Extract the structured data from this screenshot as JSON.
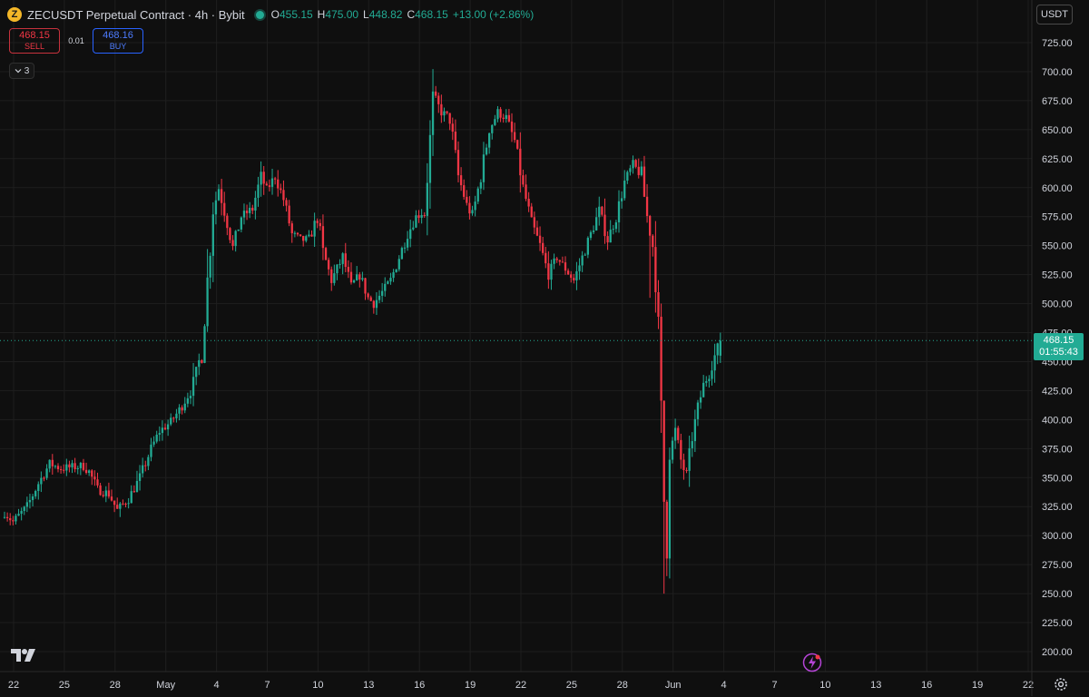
{
  "header": {
    "coin_glyph": "Z",
    "symbol_title": "ZECUSDT Perpetual Contract · 4h · Bybit",
    "ohlc": [
      {
        "key": "O",
        "value": "455.15"
      },
      {
        "key": "H",
        "value": "475.00"
      },
      {
        "key": "L",
        "value": "448.82"
      },
      {
        "key": "C",
        "value": "468.15"
      },
      {
        "key": "",
        "value": "+13.00 (+2.86%)"
      }
    ]
  },
  "trade": {
    "sell_price": "468.15",
    "sell_label": "SELL",
    "spread": "0.01",
    "buy_price": "468.16",
    "buy_label": "BUY"
  },
  "indicators_collapse": {
    "icon": "chevron-down-icon",
    "count": "3"
  },
  "currency": "USDT",
  "last_price": {
    "price": "468.15",
    "countdown": "01:55:43"
  },
  "colors": {
    "up": "#22ab94",
    "down": "#f23645",
    "bg": "#0f0f0f",
    "grid": "#1e1e1e",
    "text": "#d1d4dc"
  },
  "chart_data": {
    "type": "candlestick",
    "interval": "4h",
    "y_axis": {
      "min": 200,
      "max": 725,
      "step": 25,
      "ticks": [
        "200.00",
        "225.00",
        "250.00",
        "275.00",
        "300.00",
        "325.00",
        "350.00",
        "375.00",
        "400.00",
        "425.00",
        "450.00",
        "475.00",
        "500.00",
        "525.00",
        "550.00",
        "575.00",
        "600.00",
        "625.00",
        "650.00",
        "675.00",
        "700.00",
        "725.00"
      ]
    },
    "x_axis": {
      "start_label_index": 0,
      "ticks": [
        "22",
        "25",
        "28",
        "May",
        "4",
        "7",
        "10",
        "13",
        "16",
        "19",
        "22",
        "25",
        "28",
        "Jun",
        "4",
        "7",
        "10",
        "13",
        "16",
        "19",
        "22"
      ],
      "candles_per_tick": 18,
      "total_days": 60
    },
    "grid": true,
    "last_close": 468.15,
    "anchors": [
      [
        0,
        320
      ],
      [
        3,
        312
      ],
      [
        8,
        325
      ],
      [
        12,
        345
      ],
      [
        16,
        362
      ],
      [
        20,
        358
      ],
      [
        28,
        360
      ],
      [
        30,
        355
      ],
      [
        33,
        340
      ],
      [
        37,
        336
      ],
      [
        40,
        322
      ],
      [
        44,
        332
      ],
      [
        48,
        350
      ],
      [
        52,
        375
      ],
      [
        55,
        390
      ],
      [
        59,
        398
      ],
      [
        63,
        412
      ],
      [
        66,
        425
      ],
      [
        68,
        440
      ],
      [
        70,
        460
      ],
      [
        72,
        520
      ],
      [
        74,
        580
      ],
      [
        76,
        600
      ],
      [
        79,
        570
      ],
      [
        81,
        548
      ],
      [
        84,
        575
      ],
      [
        88,
        582
      ],
      [
        91,
        610
      ],
      [
        93,
        598
      ],
      [
        96,
        610
      ],
      [
        99,
        590
      ],
      [
        102,
        560
      ],
      [
        105,
        555
      ],
      [
        108,
        555
      ],
      [
        111,
        575
      ],
      [
        113,
        545
      ],
      [
        116,
        520
      ],
      [
        120,
        540
      ],
      [
        123,
        515
      ],
      [
        126,
        525
      ],
      [
        129,
        505
      ],
      [
        131,
        500
      ],
      [
        134,
        510
      ],
      [
        137,
        520
      ],
      [
        140,
        540
      ],
      [
        143,
        560
      ],
      [
        146,
        575
      ],
      [
        149,
        580
      ],
      [
        151,
        640
      ],
      [
        152,
        680
      ],
      [
        155,
        665
      ],
      [
        158,
        660
      ],
      [
        161,
        610
      ],
      [
        164,
        585
      ],
      [
        166,
        575
      ],
      [
        169,
        610
      ],
      [
        172,
        650
      ],
      [
        175,
        665
      ],
      [
        178,
        660
      ],
      [
        181,
        640
      ],
      [
        184,
        600
      ],
      [
        187,
        570
      ],
      [
        190,
        550
      ],
      [
        193,
        525
      ],
      [
        196,
        540
      ],
      [
        199,
        530
      ],
      [
        202,
        520
      ],
      [
        205,
        540
      ],
      [
        208,
        560
      ],
      [
        211,
        580
      ],
      [
        214,
        555
      ],
      [
        217,
        575
      ],
      [
        220,
        605
      ],
      [
        223,
        620
      ],
      [
        226,
        610
      ],
      [
        228,
        575
      ],
      [
        230,
        550
      ],
      [
        231,
        530
      ],
      [
        232,
        470
      ],
      [
        233,
        400
      ],
      [
        234,
        330
      ],
      [
        235,
        300
      ],
      [
        236,
        370
      ],
      [
        238,
        390
      ],
      [
        240,
        365
      ],
      [
        242,
        350
      ],
      [
        244,
        385
      ],
      [
        246,
        410
      ],
      [
        248,
        430
      ],
      [
        250,
        440
      ],
      [
        252,
        455
      ],
      [
        254,
        468.15
      ]
    ],
    "shocks": [
      [
        234,
        250
      ],
      [
        229,
        505
      ]
    ]
  }
}
